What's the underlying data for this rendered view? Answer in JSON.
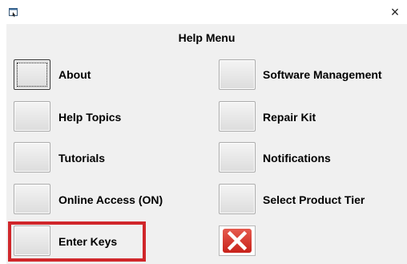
{
  "window": {
    "title": "",
    "close_glyph": "×"
  },
  "menu": {
    "title": "Help Menu"
  },
  "buttons": {
    "about": "About",
    "help_topics": "Help Topics",
    "tutorials": "Tutorials",
    "online_access": "Online Access (ON)",
    "enter_keys": "Enter Keys",
    "software_management": "Software Management",
    "repair_kit": "Repair Kit",
    "notifications": "Notifications",
    "select_product_tier": "Select Product Tier"
  },
  "icons": {
    "app": "window-app-icon",
    "close": "close-icon",
    "exit": "red-x-exit-icon"
  },
  "colors": {
    "highlight": "#d0262a",
    "exit_red": "#c8211a"
  }
}
